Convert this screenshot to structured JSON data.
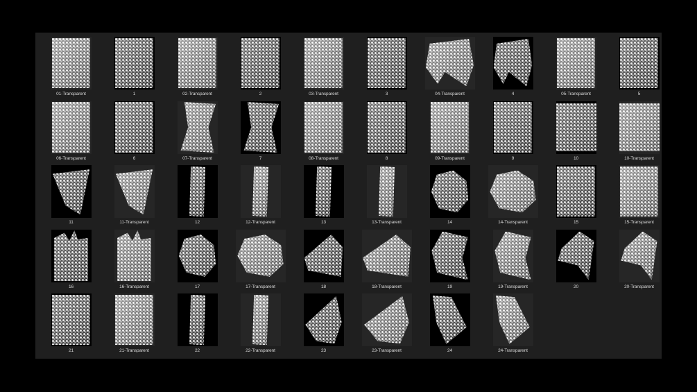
{
  "items": [
    {
      "label": "01-Transparent",
      "shape": "s-rect",
      "transparent": true
    },
    {
      "label": "1",
      "shape": "s-rect",
      "transparent": false
    },
    {
      "label": "02-Transparent",
      "shape": "s-rect",
      "transparent": true
    },
    {
      "label": "2",
      "shape": "s-rect",
      "transparent": false
    },
    {
      "label": "03-Transparent",
      "shape": "s-rect",
      "transparent": true
    },
    {
      "label": "3",
      "shape": "s-rect",
      "transparent": false
    },
    {
      "label": "04-Transparent",
      "shape": "s-blob",
      "transparent": true,
      "wide": true
    },
    {
      "label": "4",
      "shape": "s-blob",
      "transparent": false
    },
    {
      "label": "05-Transparent",
      "shape": "s-rect",
      "transparent": true
    },
    {
      "label": "5",
      "shape": "s-rect",
      "transparent": false
    },
    {
      "label": "06-Transparent",
      "shape": "s-rect",
      "transparent": true
    },
    {
      "label": "6",
      "shape": "s-rect",
      "transparent": false
    },
    {
      "label": "07-Transparent",
      "shape": "s-bow",
      "transparent": true
    },
    {
      "label": "7",
      "shape": "s-bow",
      "transparent": false
    },
    {
      "label": "08-Transparent",
      "shape": "s-rect",
      "transparent": true
    },
    {
      "label": "8",
      "shape": "s-rect",
      "transparent": false
    },
    {
      "label": "09-Transparent",
      "shape": "s-rect",
      "transparent": true
    },
    {
      "label": "9",
      "shape": "s-rect",
      "transparent": false
    },
    {
      "label": "10",
      "shape": "s-band",
      "transparent": false
    },
    {
      "label": "10-Transparent",
      "shape": "s-band",
      "transparent": true
    },
    {
      "label": "11",
      "shape": "s-tri",
      "transparent": false
    },
    {
      "label": "11-Transparent",
      "shape": "s-tri",
      "transparent": true
    },
    {
      "label": "12",
      "shape": "s-strip",
      "transparent": false
    },
    {
      "label": "12-Transparent",
      "shape": "s-strip",
      "transparent": true
    },
    {
      "label": "13",
      "shape": "s-strip",
      "transparent": false
    },
    {
      "label": "13-Transparent",
      "shape": "s-strip",
      "transparent": true
    },
    {
      "label": "14",
      "shape": "s-crum",
      "transparent": false
    },
    {
      "label": "14-Transparent",
      "shape": "s-crum",
      "transparent": true,
      "wide": true
    },
    {
      "label": "15",
      "shape": "s-rect",
      "transparent": false
    },
    {
      "label": "15-Transparent",
      "shape": "s-rect",
      "transparent": true
    },
    {
      "label": "16",
      "shape": "s-puzzle",
      "transparent": false
    },
    {
      "label": "16-Transparent",
      "shape": "s-puzzle",
      "transparent": true
    },
    {
      "label": "17",
      "shape": "s-crum",
      "transparent": false
    },
    {
      "label": "17-Transparent",
      "shape": "s-crum",
      "transparent": true,
      "wide": true
    },
    {
      "label": "18",
      "shape": "s-wedge",
      "transparent": false
    },
    {
      "label": "18-Transparent",
      "shape": "s-wedge",
      "transparent": true,
      "wide": true
    },
    {
      "label": "19",
      "shape": "s-shard",
      "transparent": false
    },
    {
      "label": "19-Transparent",
      "shape": "s-shard",
      "transparent": true
    },
    {
      "label": "20",
      "shape": "s-spike",
      "transparent": false
    },
    {
      "label": "20-Transparent",
      "shape": "s-spike",
      "transparent": true
    },
    {
      "label": "21",
      "shape": "s-rect",
      "transparent": false
    },
    {
      "label": "21-Transparent",
      "shape": "s-rect",
      "transparent": true
    },
    {
      "label": "22",
      "shape": "s-strip",
      "transparent": false
    },
    {
      "label": "22-Transparent",
      "shape": "s-strip",
      "transparent": true
    },
    {
      "label": "23",
      "shape": "s-peak",
      "transparent": false
    },
    {
      "label": "23-Transparent",
      "shape": "s-peak",
      "transparent": true,
      "wide": true
    },
    {
      "label": "24",
      "shape": "s-kite",
      "transparent": false
    },
    {
      "label": "24-Transparent",
      "shape": "s-kite",
      "transparent": true
    }
  ]
}
